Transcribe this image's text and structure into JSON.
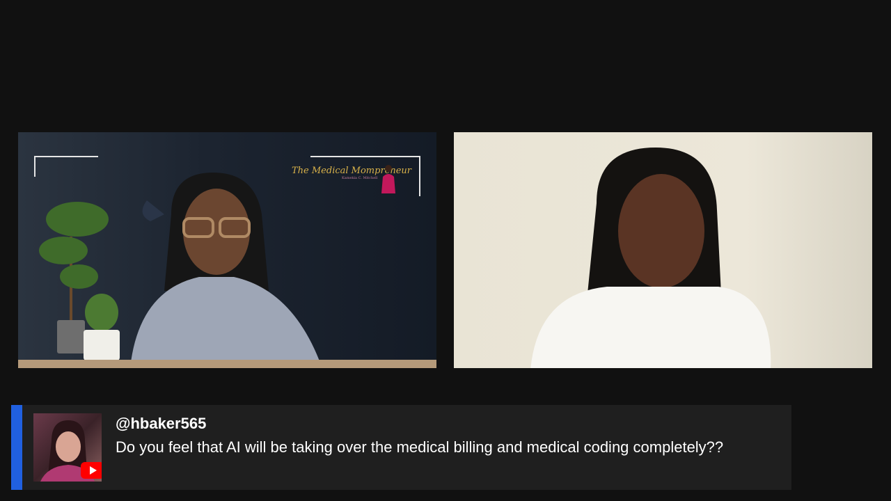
{
  "video_tiles": {
    "left": {
      "brand_logo_text": "The Medical Mompreneur",
      "brand_logo_subtext": "Kamekia C. Mitchell"
    },
    "right": {}
  },
  "chat_highlight": {
    "author": "@hbaker565",
    "message": "Do you feel that AI will be taking over the medical billing and medical coding completely??",
    "badge_icon": "youtube-icon",
    "accent_color": "#2060e0"
  },
  "colors": {
    "background": "#111111",
    "card": "#1f1f1f",
    "youtube_red": "#ff0000"
  }
}
